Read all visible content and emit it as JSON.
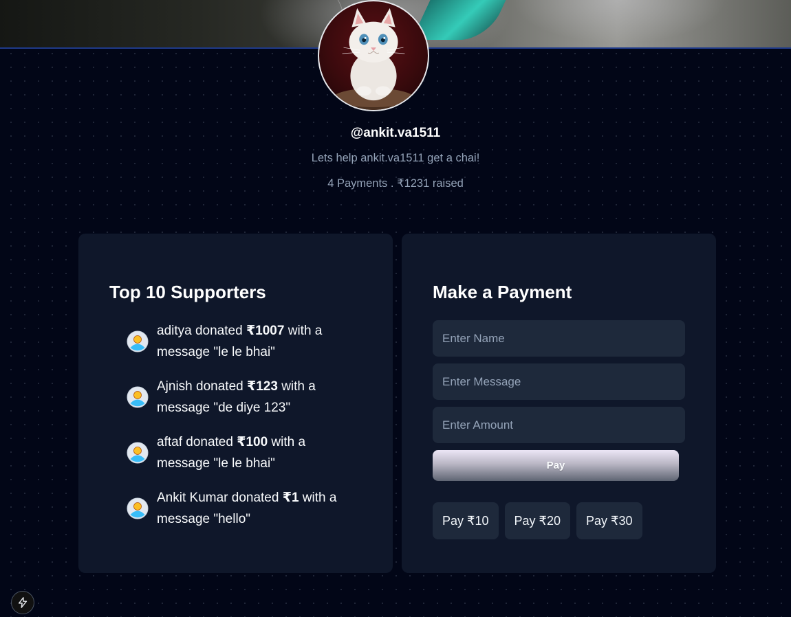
{
  "header": {
    "username": "@ankit.va1511",
    "tagline": "Lets help ankit.va1511 get a chai!",
    "stats": "4 Payments . ₹1231 raised"
  },
  "supporters": {
    "title": "Top 10 Supporters",
    "items": [
      {
        "name": "aditya",
        "mid": " donated ",
        "amount": "₹1007",
        "rest": " with a message \"le le bhai\""
      },
      {
        "name": "Ajnish",
        "mid": " donated ",
        "amount": "₹123",
        "rest": " with a message \"de diye 123\""
      },
      {
        "name": "aftaf",
        "mid": " donated ",
        "amount": "₹100",
        "rest": " with a message \"le le bhai\""
      },
      {
        "name": "Ankit Kumar",
        "mid": " donated ",
        "amount": "₹1",
        "rest": " with a message \"hello\""
      }
    ]
  },
  "payment": {
    "title": "Make a Payment",
    "name_placeholder": "Enter Name",
    "message_placeholder": "Enter Message",
    "amount_placeholder": "Enter Amount",
    "pay_label": "Pay",
    "quick": [
      "Pay ₹10",
      "Pay ₹20",
      "Pay ₹30"
    ]
  },
  "icons": {
    "supporter": "user-avatar-icon",
    "corner": "lightning-icon"
  },
  "colors": {
    "background": "#020617",
    "panel": "#0f172a",
    "field": "#1e293b",
    "muted_text": "#94a3b8"
  }
}
